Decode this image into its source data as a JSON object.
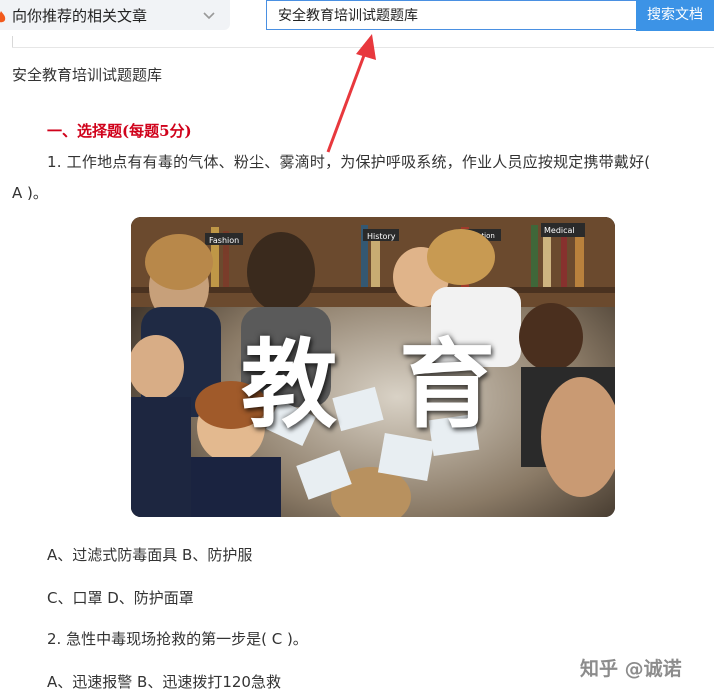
{
  "topbar": {
    "recommend_label": "向你推荐的相关文章",
    "search_value": "安全教育培训试题题库",
    "search_button": "搜索文档"
  },
  "doc": {
    "title": "安全教育培训试题题库",
    "section_heading": "一、选择题(每题5分)",
    "q1_line1": "1. 工作地点有有毒的气体、粉尘、雾滴时，为保护呼吸系统，作业人员应按规定携带戴好(",
    "q1_line2": "A  )。",
    "image_text_left": "教",
    "image_text_right": "育",
    "image_labels": [
      "Fashion",
      "History",
      "Education",
      "Medical"
    ],
    "opt1": "A、过滤式防毒面具 B、防护服",
    "opt2": "C、口罩 D、防护面罩",
    "q2": "2. 急性中毒现场抢救的第一步是(  C  )。",
    "opt3": "A、迅速报警 B、迅速拨打120急救"
  },
  "watermark": "知乎 @诚诺",
  "colors": {
    "accent_blue": "#3c93e6",
    "heading_red": "#d0021b",
    "arrow_red": "#e8383d"
  }
}
